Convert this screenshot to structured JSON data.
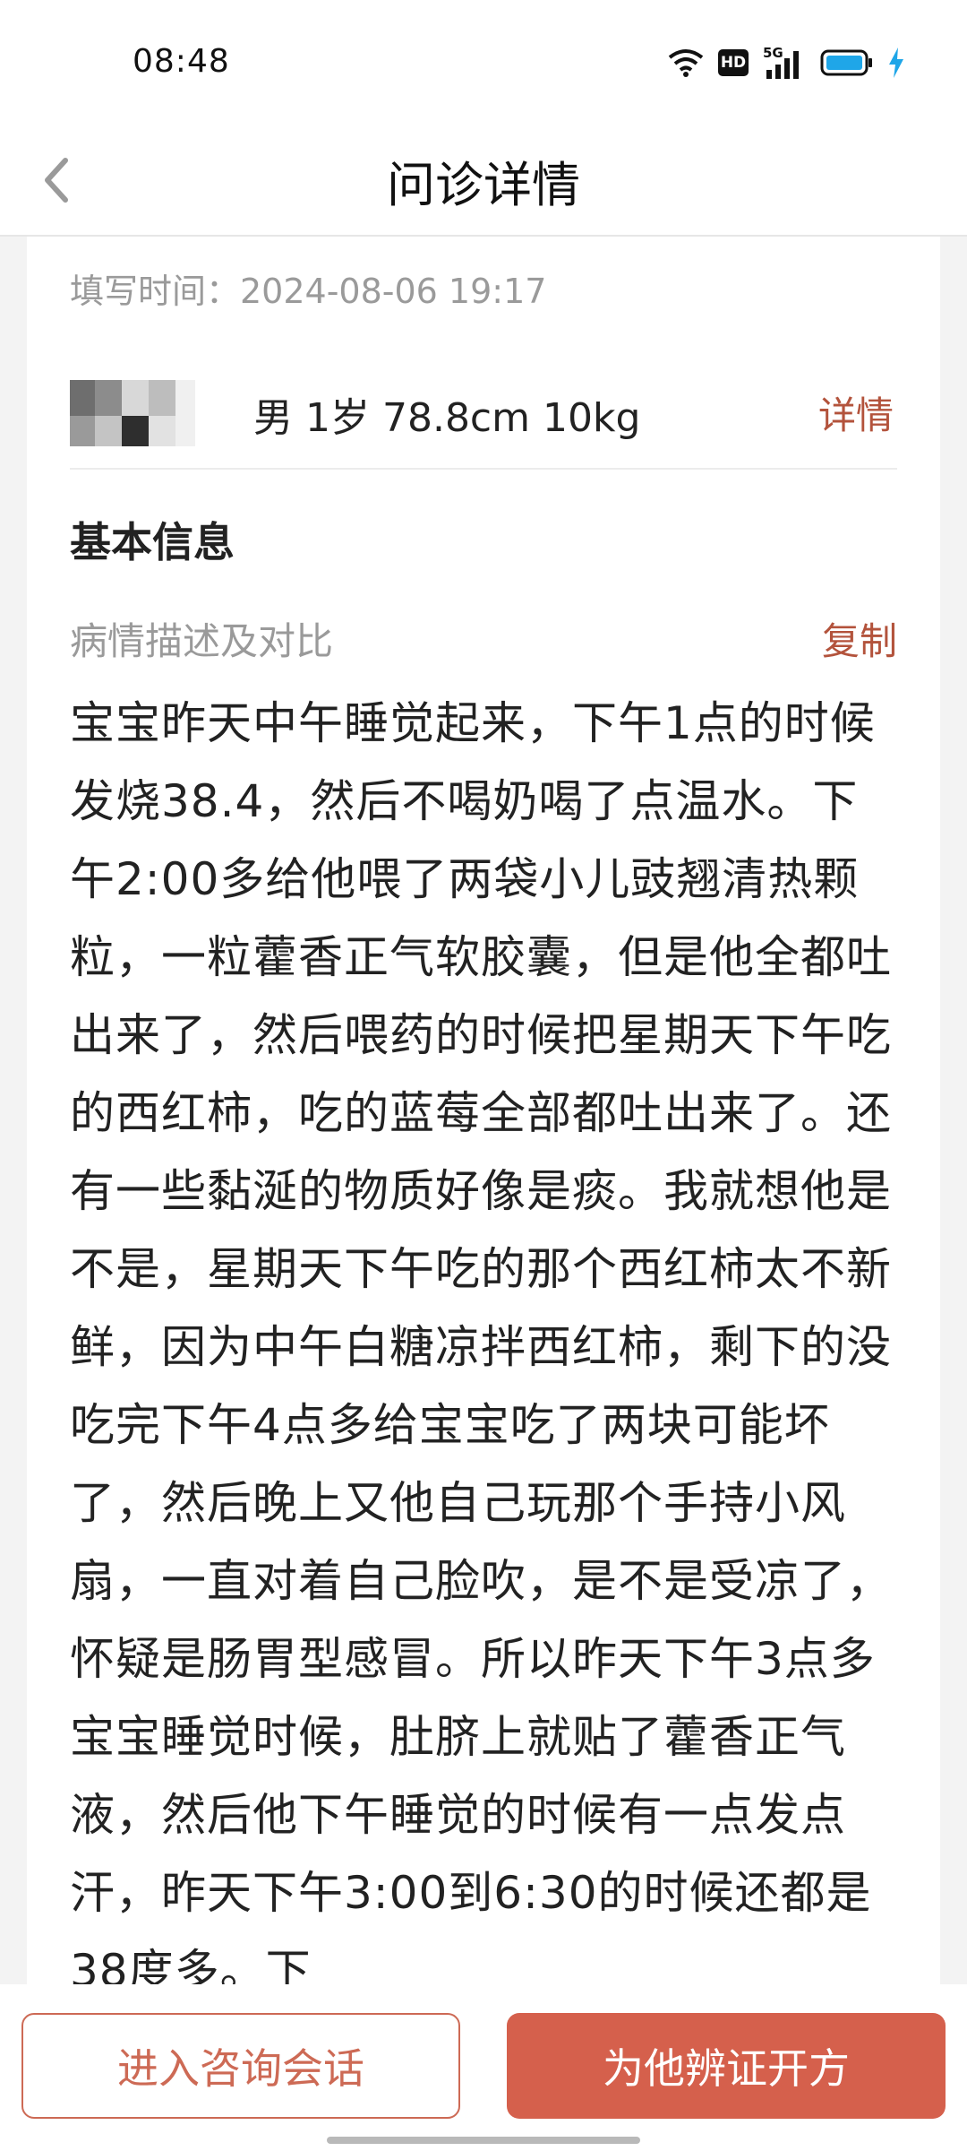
{
  "status_bar": {
    "time": "08:48",
    "icons": [
      "wifi-icon",
      "hd-icon",
      "signal-5g-icon",
      "battery-icon",
      "charging-icon"
    ],
    "hd_label": "HD",
    "network_label": "5G"
  },
  "nav": {
    "title": "问诊详情",
    "back_icon": "back-arrow-icon"
  },
  "record": {
    "fill_time": "填写时间：2024-08-06 19:17",
    "patient_summary": "男 1岁 78.8cm 10kg",
    "details_label": "详情"
  },
  "basic_info": {
    "section_title": "基本信息",
    "field_label": "病情描述及对比",
    "copy_label": "复制",
    "description": "宝宝昨天中午睡觉起来，下午1点的时候发烧38.4，然后不喝奶喝了点温水。下午2:00多给他喂了两袋小儿豉翘清热颗粒，一粒藿香正气软胶囊，但是他全都吐出来了，然后喂药的时候把星期天下午吃的西红柿，吃的蓝莓全部都吐出来了。还有一些黏涎的物质好像是痰。我就想他是不是，星期天下午吃的那个西红柿太不新鲜，因为中午白糖凉拌西红柿，剩下的没吃完下午4点多给宝宝吃了两块可能坏了，然后晚上又他自己玩那个手持小风扇，一直对着自己脸吹，是不是受凉了，怀疑是肠胃型感冒。所以昨天下午3点多宝宝睡觉时候，肚脐上就贴了藿香正气液，然后他下午睡觉的时候有一点发点汗，昨天下午3:00到6:30的时候还都是38度多。下"
  },
  "actions": {
    "consult_label": "进入咨询会话",
    "prescribe_label": "为他辨证开方"
  },
  "colors": {
    "accent": "#b3533c",
    "primary_button": "#d5604c",
    "muted_text": "#9a9a9a"
  }
}
